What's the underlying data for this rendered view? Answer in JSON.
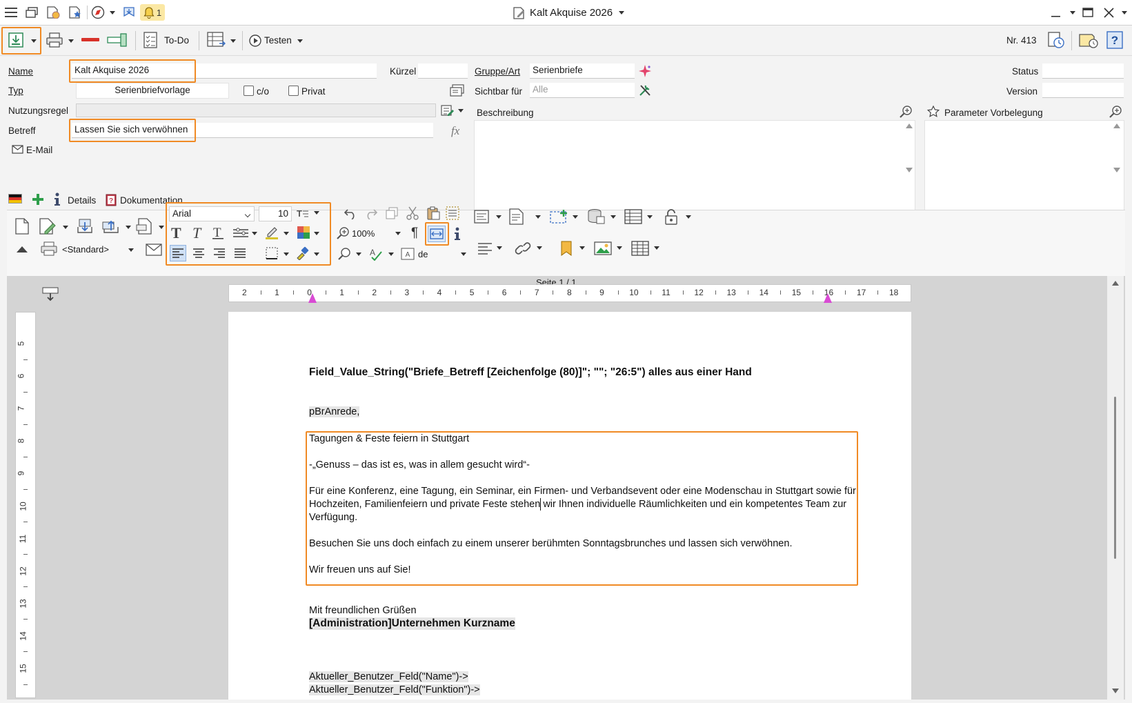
{
  "titlebar": {
    "title": "Kalt Akquise 2026",
    "bell_count": "1"
  },
  "toolbar": {
    "todo_label": "To-Do",
    "test_label": "Testen",
    "record_number": "Nr. 413"
  },
  "form": {
    "name_label": "Name",
    "name_value": "Kalt Akquise 2026",
    "kuerzel_label": "Kürzel",
    "kuerzel_value": "",
    "gruppe_label": "Gruppe/Art",
    "gruppe_value": "Serienbriefe",
    "status_label": "Status",
    "status_value": "",
    "typ_label": "Typ",
    "typ_value": "Serienbriefvorlage",
    "co_label": "c/o",
    "privat_label": "Privat",
    "sichtbar_label": "Sichtbar für",
    "sichtbar_placeholder": "Alle",
    "version_label": "Version",
    "version_value": "",
    "nutzungsregel_label": "Nutzungsregel",
    "nutzungsregel_value": "",
    "betreff_label": "Betreff",
    "betreff_value": "Lassen Sie sich verwöhnen",
    "email_label": "E-Mail",
    "beschreibung_label": "Beschreibung",
    "parameter_label": "Parameter Vorbelegung"
  },
  "tabs": {
    "details_label": "Details",
    "dokumentation_label": "Dokumentation"
  },
  "editor_toolbar": {
    "font": "Arial",
    "font_size": "10",
    "zoom": "100%",
    "print_style": "<Standard>",
    "language": "de"
  },
  "ruler": {
    "page_label": "Seite 1 / 1",
    "h_numbers": [
      "2",
      "1",
      "0",
      "1",
      "2",
      "3",
      "4",
      "5",
      "6",
      "7",
      "8",
      "9",
      "10",
      "11",
      "12",
      "13",
      "14",
      "15",
      "16",
      "17",
      "18"
    ],
    "v_numbers": [
      "5",
      "6",
      "7",
      "8",
      "9",
      "10",
      "11",
      "12",
      "13",
      "14",
      "15"
    ]
  },
  "document": {
    "subject_line": "Field_Value_String(\"Briefe_Betreff [Zeichenfolge (80)]\"; \"\"; \"26:5\") alles aus einer Hand",
    "salutation": "pBrAnrede,",
    "p1": "Tagungen & Feste feiern in Stuttgart",
    "p2": "-„Genuss – das ist es, was in allem gesucht wird“-",
    "p3a": "Für eine Konferenz, eine Tagung, ein Seminar, ein Firmen- und Verbandsevent oder eine Modenschau in Stuttgart sowie für",
    "p3b": "Hochzeiten, Familienfeiern und private Feste stehen wir Ihnen individuelle Räumlichkeiten und ein kompetentes Team zur",
    "p3c": "Verfügung.",
    "p4": "Besuchen Sie uns doch einfach zu einem unserer berühmten Sonntagsbrunches und lassen sich verwöhnen.",
    "p5": "Wir freuen uns auf Sie!",
    "closing": "Mit freundlichen Grüßen",
    "company": "[Administration]Unternehmen Kurzname",
    "user_name": "Aktueller_Benutzer_Feld(\"Name\")->",
    "user_function": "Aktueller_Benutzer_Feld(\"Funktion\")->"
  }
}
